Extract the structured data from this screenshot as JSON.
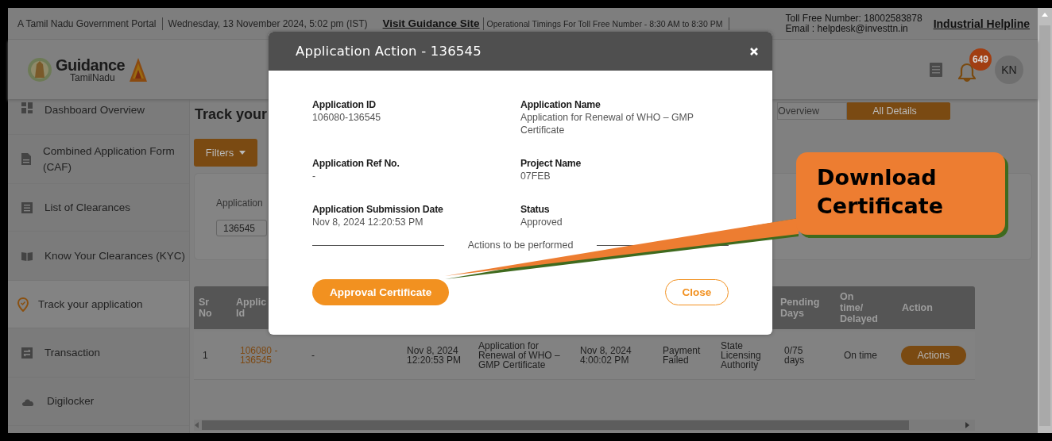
{
  "top_bar": {
    "portal": "A Tamil Nadu Government Portal",
    "datetime": "Wednesday, 13 November 2024, 5:02 pm (IST)",
    "guidance_link": "Visit Guidance Site",
    "timings": "Operational Timings For Toll Free Number - 8:30 AM to 8:30 PM",
    "toll_free": "Toll Free Number: 18002583878",
    "email": "Email : helpdesk@investtn.in",
    "helpline_link": "Industrial Helpline"
  },
  "header": {
    "logo_text": "Guidance",
    "logo_subtext": "TamilNadu",
    "notification_count": "649",
    "avatar": "KN"
  },
  "sidebar": {
    "items": [
      {
        "label": "Dashboard Overview",
        "selected": false
      },
      {
        "label": "Combined Application Form (CAF)",
        "selected": false
      },
      {
        "label": "List of Clearances",
        "selected": false
      },
      {
        "label": "Know Your Clearances (KYC)",
        "selected": false
      },
      {
        "label": "Track your application",
        "selected": true
      },
      {
        "label": "Transaction",
        "selected": false
      },
      {
        "label": "Digilocker",
        "selected": false
      }
    ]
  },
  "main": {
    "title": "Track your",
    "tabs": [
      {
        "label": "Overview",
        "selected": false
      },
      {
        "label": "All Details",
        "selected": true
      }
    ],
    "filters_button": "Filters",
    "filter": {
      "label": "Application",
      "value": "136545"
    },
    "table": {
      "columns": [
        "Sr No",
        "Applic Id",
        "",
        "",
        "",
        "",
        "",
        "",
        "Pending Days",
        "On time/ Delayed",
        "Action"
      ],
      "rows": [
        {
          "cells": [
            "1",
            "106080 - 136545",
            "-",
            "Nov 8, 2024 12:20:53 PM",
            "Application for Renewal of WHO – GMP Certificate",
            "Nov 8, 2024 4:00:02 PM",
            "Payment Failed",
            "State Licensing Authority",
            "0/75 days",
            "On time"
          ],
          "action": "Actions"
        }
      ]
    }
  },
  "modal": {
    "title": "Application Action - 136545",
    "fields": [
      {
        "label": "Application ID",
        "value": "106080-136545"
      },
      {
        "label": "Application Name",
        "value": "Application for Renewal of WHO – GMP Certificate"
      },
      {
        "label": "Application Ref No.",
        "value": "-"
      },
      {
        "label": "Project Name",
        "value": "07FEB"
      },
      {
        "label": "Application Submission Date",
        "value": "Nov 8, 2024 12:20:53 PM"
      },
      {
        "label": "Status",
        "value": "Approved"
      }
    ],
    "actions_heading": "Actions to be performed",
    "primary_button": "Approval Certificate",
    "close_button": "Close"
  },
  "callout": {
    "text": "Download Certificate"
  }
}
